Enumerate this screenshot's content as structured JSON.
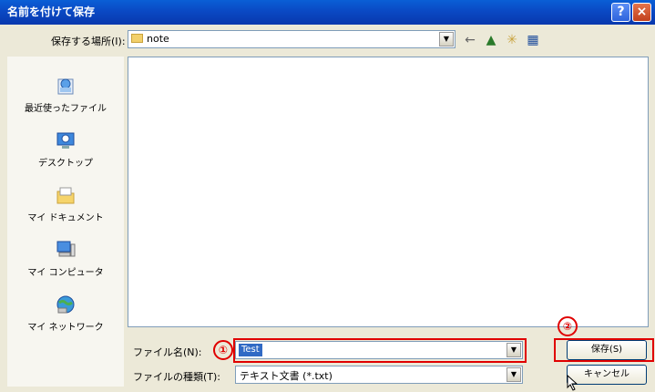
{
  "window": {
    "title": "名前を付けて保存",
    "help_label": "?",
    "close_label": "×"
  },
  "save_in": {
    "label": "保存する場所(I):",
    "value": "note"
  },
  "toolbar": {
    "back_icon": "←",
    "up_icon": "▲",
    "new_folder_icon": "✳",
    "view_icon": "▦"
  },
  "places": [
    {
      "label": "最近使ったファイル",
      "icon": "recent-icon"
    },
    {
      "label": "デスクトップ",
      "icon": "desktop-icon"
    },
    {
      "label": "マイ ドキュメント",
      "icon": "my-documents-icon"
    },
    {
      "label": "マイ コンピュータ",
      "icon": "my-computer-icon"
    },
    {
      "label": "マイ ネットワーク",
      "icon": "my-network-icon"
    }
  ],
  "filename": {
    "label": "ファイル名(N):",
    "value": "Test"
  },
  "filetype": {
    "label": "ファイルの種類(T):",
    "value": "テキスト文書 (*.txt)"
  },
  "buttons": {
    "save_label": "保存(S)",
    "cancel_label": "キャンセル"
  },
  "markers": {
    "one": "①",
    "two": "②"
  },
  "colors": {
    "highlight": "#e00000",
    "titlebar": "#0a49c4"
  }
}
